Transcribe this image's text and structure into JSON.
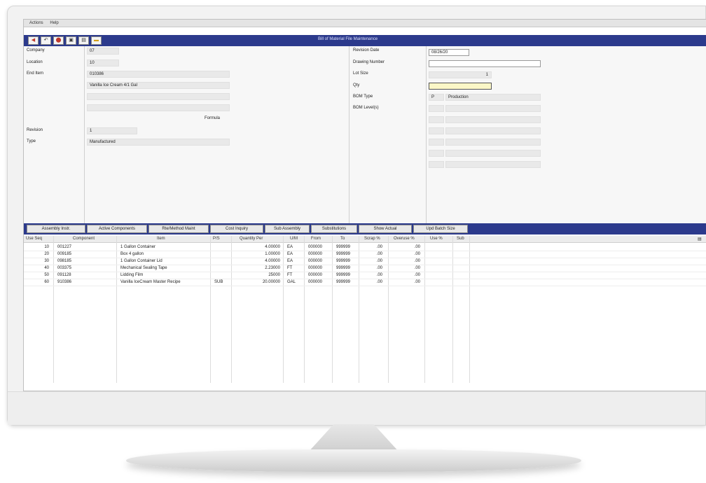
{
  "menu": [
    "Actions",
    "Help"
  ],
  "window_title": "Bill of Material File Maintenance",
  "toolbar_icons": [
    "back-arrow-icon",
    "undo-icon",
    "stop-icon",
    "save-icon",
    "print-icon",
    "folder-icon"
  ],
  "form": {
    "company_label": "Company",
    "company": "07",
    "location_label": "Location",
    "location": "10",
    "end_item_label": "End Item",
    "end_item": "010386",
    "description": "Vanilla Ice Cream 4/1 Gal",
    "formula_label": "Formula",
    "revision_label": "Revision",
    "revision": "1",
    "type_label": "Type",
    "type": "Manufactured",
    "revision_date_label": "Revision Date",
    "revision_date": "08/26/20",
    "drawing_number_label": "Drawing Number",
    "drawing_number": "",
    "lot_size_label": "Lot Size",
    "lot_size": "1",
    "qty_label": "Qty",
    "qty": "",
    "bom_type_label": "BOM Type",
    "bom_type_code": "P",
    "bom_type": "Production",
    "bom_levels_label": "BOM Level(s)"
  },
  "buttons": [
    "Assembly Instr.",
    "Active Components",
    "Rte/Method Maint",
    "Cost Inquiry",
    "Sub Assembly",
    "Substitutions",
    "Show Actual",
    "Upd Batch Size"
  ],
  "grid": {
    "columns": [
      "Use Seq",
      "Component",
      "Item",
      "P/S",
      "Quantity Per",
      "U/M",
      "From",
      "To",
      "Scrap %",
      "Overuse %",
      "Use %",
      "Sub"
    ],
    "rows": [
      [
        "10",
        "001227",
        "1 Gallon Container",
        "",
        "4.00000",
        "EA",
        "000000",
        "999999",
        ".00",
        ".00"
      ],
      [
        "20",
        "009185",
        "Box 4 gallon",
        "",
        "1.00000",
        "EA",
        "000000",
        "999999",
        ".00",
        ".00"
      ],
      [
        "30",
        "098185",
        "1 Gallon Container Lid",
        "",
        "4.00000",
        "EA",
        "000000",
        "999999",
        ".00",
        ".00"
      ],
      [
        "40",
        "003375",
        "Mechanical Sealing Tape",
        "",
        "2.23000",
        "FT",
        "000000",
        "999999",
        ".00",
        ".00"
      ],
      [
        "50",
        "091128",
        "Lidding Film",
        "",
        "25000",
        "FT",
        "000000",
        "999999",
        ".00",
        ".00"
      ],
      [
        "60",
        "910386",
        "Vanilla IceCream Master Recipe",
        "SUB",
        "20.00000",
        "GAL",
        "000000",
        "999999",
        ".00",
        ".00"
      ]
    ]
  }
}
